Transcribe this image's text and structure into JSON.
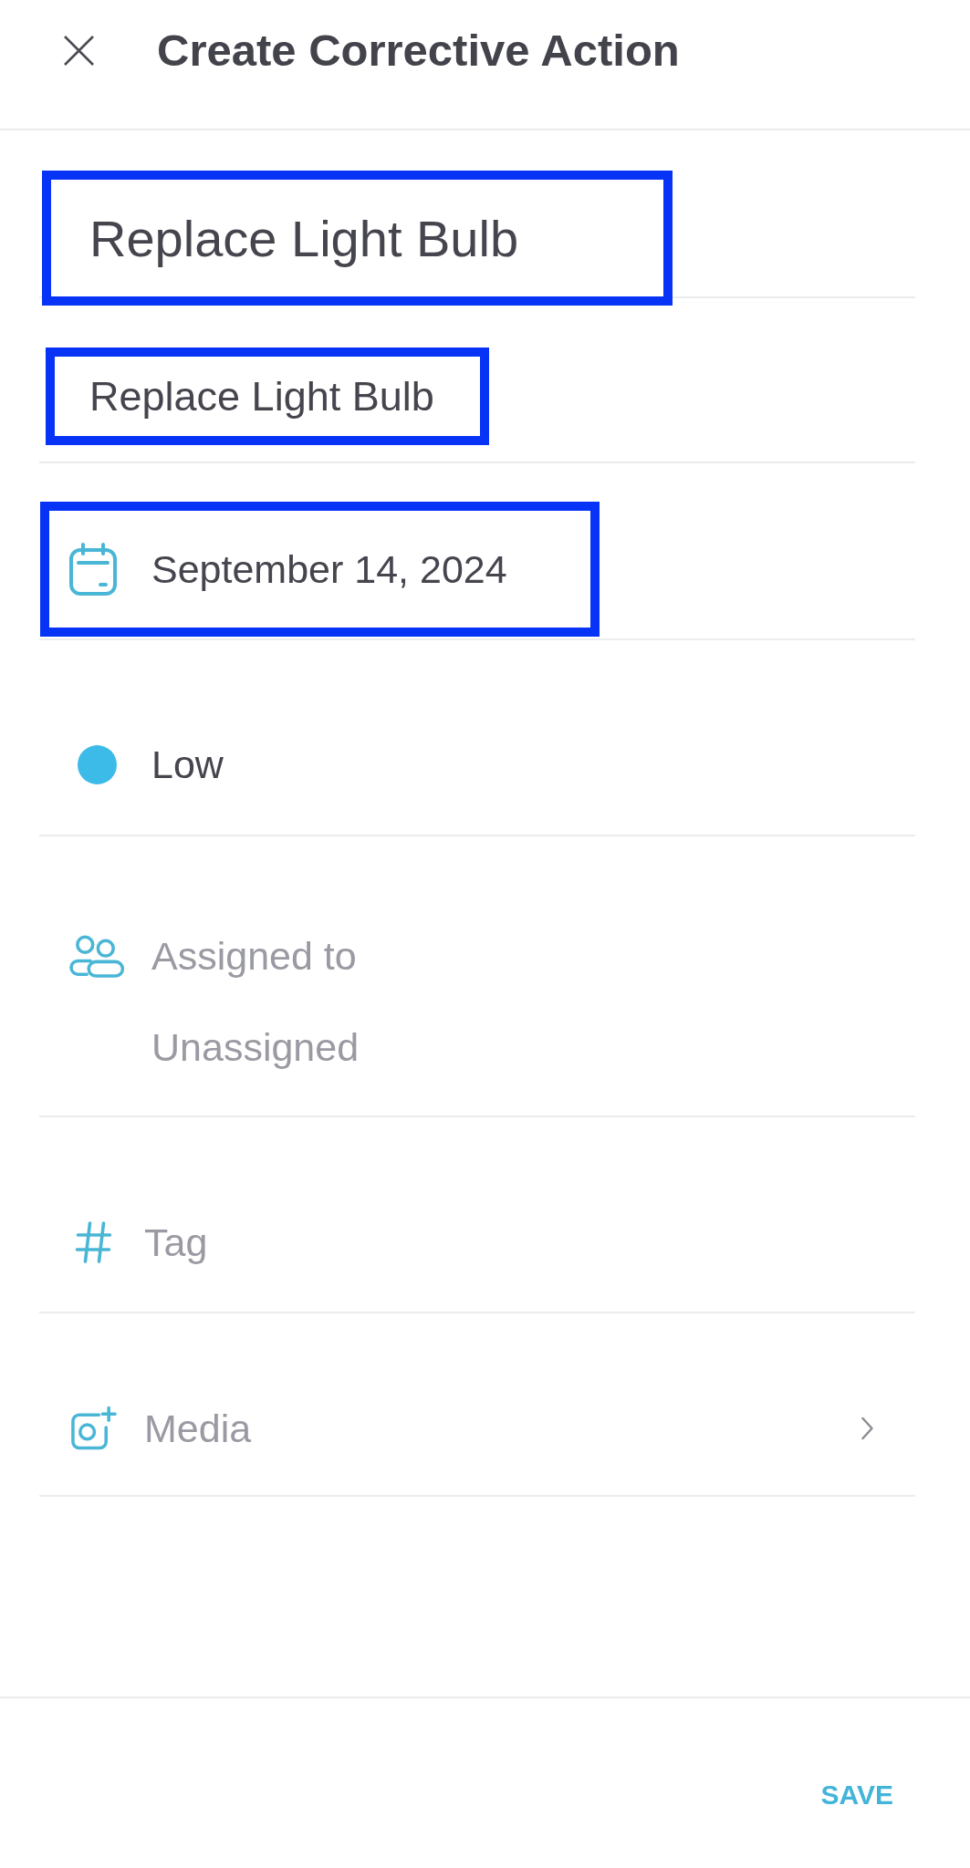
{
  "header": {
    "title": "Create Corrective Action"
  },
  "fields": [
    {
      "kind": "title",
      "value": "Replace Light Bulb",
      "highlighted": true
    },
    {
      "kind": "description",
      "value": "Replace Light Bulb",
      "highlighted": true
    },
    {
      "kind": "date",
      "value": "September 14, 2024",
      "highlighted": true
    },
    {
      "kind": "priority",
      "value": "Low",
      "color": "#3cbbe8",
      "highlighted": false
    },
    {
      "kind": "assignee",
      "label": "Assigned to",
      "value": "Unassigned",
      "highlighted": false
    },
    {
      "kind": "tag",
      "placeholder": "Tag",
      "highlighted": false
    },
    {
      "kind": "media",
      "label": "Media",
      "highlighted": false
    }
  ],
  "footer": {
    "save_button": "SAVE"
  }
}
